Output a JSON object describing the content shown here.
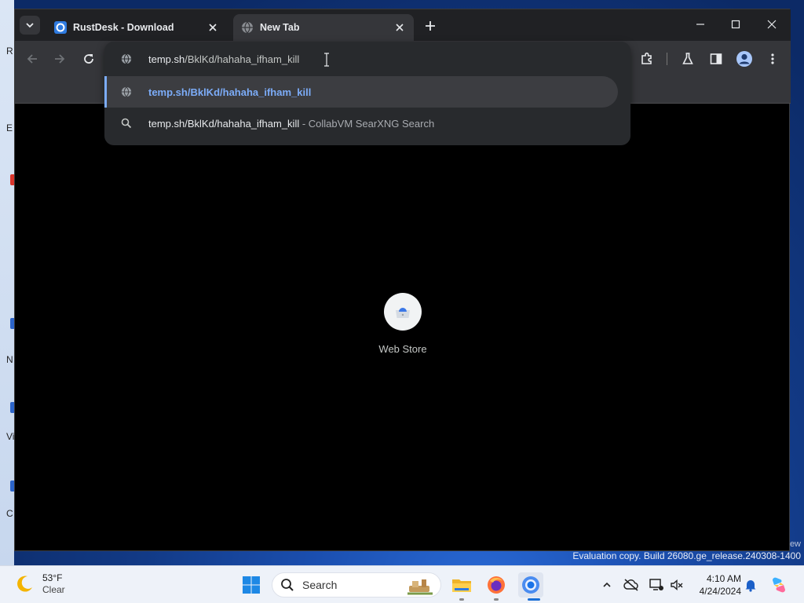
{
  "desktop": {
    "left_labels": [
      "R",
      "E",
      "N",
      "Vi",
      "C"
    ],
    "watermark_tail": "ew",
    "watermark": "Evaluation copy. Build 26080.ge_release.240308-1400"
  },
  "browser": {
    "tabs": [
      {
        "title": "RustDesk - Download",
        "favicon": "rustdesk-icon",
        "active": false
      },
      {
        "title": "New Tab",
        "favicon": "globe-icon",
        "active": true
      }
    ],
    "omnibox": {
      "input_host": "temp.sh",
      "input_path": "/BklKd/hahaha_ifham_kill",
      "suggestions": [
        {
          "icon": "globe-icon",
          "text": "temp.sh/BklKd/hahaha_ifham_kill",
          "description": ""
        },
        {
          "icon": "search-icon",
          "text": "temp.sh/BklKd/hahaha_ifham_kill",
          "description": " - CollabVM SearXNG Search"
        }
      ]
    },
    "new_tab": {
      "shortcut_label": "Web Store"
    },
    "colors": {
      "accent": "#7cacf8",
      "tabstrip": "#202124",
      "toolbar": "#35363a",
      "dropdown": "#282a2d"
    }
  },
  "taskbar": {
    "weather": {
      "temp": "53°F",
      "condition": "Clear"
    },
    "search_label": "Search",
    "clock": {
      "time": "4:10 AM",
      "date": "4/24/2024"
    }
  }
}
